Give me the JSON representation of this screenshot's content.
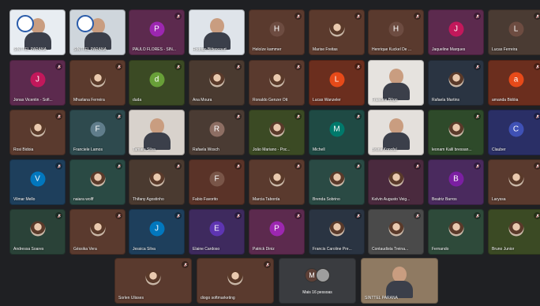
{
  "colors": {
    "background": "#1f2023",
    "mic_muted": "#e57373"
  },
  "more_tile": {
    "avatars": [
      {
        "initial": "M",
        "color": "#5d4037"
      },
      {
        "initial": "",
        "color": "#9e9e9e"
      }
    ],
    "label": "Mais 16 pessoas"
  },
  "rows": [
    [
      {
        "name": "SINTTEL PARANÁ",
        "kind": "video",
        "bg": "#e8edf2"
      },
      {
        "name": "SINTTEL PARANÁ",
        "kind": "video",
        "bg": "#cfd6dc"
      },
      {
        "name": "PAULO FLORES - SIN...",
        "kind": "letter",
        "initial": "P",
        "bg": "#5c2a4e",
        "circle": "#9c27b0"
      },
      {
        "name": "Rodrigo Bittencourt",
        "kind": "video",
        "bg": "#dfe4ea"
      },
      {
        "name": "Heloíze kammer",
        "kind": "letter",
        "initial": "H",
        "bg": "#5a3a2e",
        "circle": "#6d4c41"
      },
      {
        "name": "Marise Freitas",
        "kind": "photo",
        "bg": "#5b3a2d"
      },
      {
        "name": "Henrique Kuckel De ...",
        "kind": "letter",
        "initial": "H",
        "bg": "#5a3a2e",
        "circle": "#6d4c41"
      },
      {
        "name": "Jaqueline Marques",
        "kind": "letter",
        "initial": "J",
        "bg": "#5c2a4e",
        "circle": "#c2185b"
      },
      {
        "name": "Lucas Ferreira",
        "kind": "letter",
        "initial": "L",
        "bg": "#4a3b33",
        "circle": "#6d4c41"
      }
    ],
    [
      {
        "name": "Jonas Vicentin - Sofi...",
        "kind": "letter",
        "initial": "J",
        "bg": "#5c2a4e",
        "circle": "#c2185b"
      },
      {
        "name": "Mharlana Ferreira",
        "kind": "photo",
        "bg": "#5b3a2d"
      },
      {
        "name": "duda",
        "kind": "letter",
        "initial": "d",
        "bg": "#3b4a24",
        "circle": "#689f38"
      },
      {
        "name": "Ana Moura",
        "kind": "photo",
        "bg": "#4a3a30"
      },
      {
        "name": "Ronaldo Genzer Ott",
        "kind": "photo",
        "bg": "#5a3a2e"
      },
      {
        "name": "Lucas Wanzeler",
        "kind": "letter",
        "initial": "L",
        "bg": "#6b2e1e",
        "circle": "#e64a19"
      },
      {
        "name": "Francine Bôgo",
        "kind": "video",
        "bg": "#e6e3df"
      },
      {
        "name": "Rafaela Martins",
        "kind": "photo",
        "bg": "#2a3442"
      },
      {
        "name": "amanda Bidóia",
        "kind": "letter",
        "initial": "a",
        "bg": "#6b2e1e",
        "circle": "#e64a19"
      }
    ],
    [
      {
        "name": "Rosi Bidoia",
        "kind": "photo",
        "bg": "#5a3a2e"
      },
      {
        "name": "Franciele Lamos",
        "kind": "letter",
        "initial": "F",
        "bg": "#2e4a4e",
        "circle": "#607d8b"
      },
      {
        "name": "Tamara Silva",
        "kind": "video",
        "bg": "#d8d2cc"
      },
      {
        "name": "Rafaela Wosch",
        "kind": "letter",
        "initial": "R",
        "bg": "#4a3b33",
        "circle": "#8d6e63"
      },
      {
        "name": "João Mariano - Poc...",
        "kind": "photo",
        "bg": "#3b4a24"
      },
      {
        "name": "Michell",
        "kind": "letter",
        "initial": "M",
        "bg": "#1f4a44",
        "circle": "#00796b"
      },
      {
        "name": "Bruna Konofal",
        "kind": "video",
        "bg": "#e4e0dc"
      },
      {
        "name": "leonam Kalil bressan...",
        "kind": "photo",
        "bg": "#2e4a2a"
      },
      {
        "name": "Clauber",
        "kind": "letter",
        "initial": "C",
        "bg": "#2a2f66",
        "circle": "#3f51b5"
      }
    ],
    [
      {
        "name": "Vilmar Mello",
        "kind": "letter",
        "initial": "V",
        "bg": "#1e3f5c",
        "circle": "#0277bd"
      },
      {
        "name": "naiara wolff",
        "kind": "photo",
        "bg": "#2a4a44"
      },
      {
        "name": "Thifany Agostinho",
        "kind": "photo",
        "bg": "#4a3a30"
      },
      {
        "name": "Fabio Favorito",
        "kind": "letter",
        "initial": "F",
        "bg": "#5a3328",
        "circle": "#795548"
      },
      {
        "name": "Marcia Taborda",
        "kind": "photo",
        "bg": "#5a3a2e"
      },
      {
        "name": "Brenda Sobrino",
        "kind": "photo",
        "bg": "#2a4a44"
      },
      {
        "name": "Kelvin Augusto Veig...",
        "kind": "photo",
        "bg": "#4a2a3e"
      },
      {
        "name": "Beatriz Barros",
        "kind": "letter",
        "initial": "B",
        "bg": "#4a2a5e",
        "circle": "#7b1fa2"
      },
      {
        "name": "Laryssa",
        "kind": "photo",
        "bg": "#5a3a2e"
      }
    ],
    [
      {
        "name": "Andressa Soares",
        "kind": "photo",
        "bg": "#2a4238"
      },
      {
        "name": "Géssika Vera",
        "kind": "photo",
        "bg": "#5a3a2e"
      },
      {
        "name": "Jessica Silva",
        "kind": "letter",
        "initial": "J",
        "bg": "#1e3f5c",
        "circle": "#0277bd"
      },
      {
        "name": "Elaine Cardoso",
        "kind": "letter",
        "initial": "E",
        "bg": "#3e2a5e",
        "circle": "#5e35b1"
      },
      {
        "name": "Patrick Diniz",
        "kind": "letter",
        "initial": "P",
        "bg": "#5c2a4e",
        "circle": "#9c27b0"
      },
      {
        "name": "Francis Caroline Pre...",
        "kind": "photo",
        "bg": "#2a3442"
      },
      {
        "name": "Contaudista Treina...",
        "kind": "photo",
        "bg": "#4a4a4a"
      },
      {
        "name": "Fernando",
        "kind": "photo",
        "bg": "#2e4a3a"
      },
      {
        "name": "Bruno Junior",
        "kind": "photo",
        "bg": "#3b4a24"
      }
    ],
    [
      {
        "name": "Sorlen Ulisses",
        "kind": "photo",
        "bg": "#5a3a2e"
      },
      {
        "name": "diogo softmarketing",
        "kind": "photo",
        "bg": "#5a3a2e"
      },
      {
        "name": "",
        "kind": "more",
        "bg": "#3a3c40"
      },
      {
        "name": "SINTTEL PARANÁ",
        "kind": "video",
        "bg": "#8f7a62"
      }
    ]
  ]
}
